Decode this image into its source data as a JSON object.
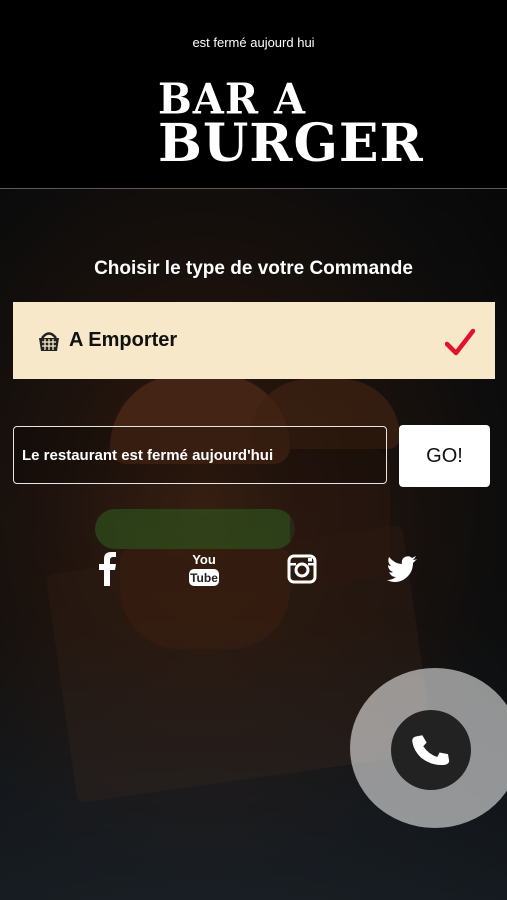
{
  "header": {
    "status_text": "est fermé aujourd hui",
    "logo_line1": "BAR A",
    "logo_line2": "BURGER"
  },
  "main": {
    "title": "Choisir le type de votre Commande",
    "order_option": {
      "label": "A Emporter",
      "selected": true,
      "icon": "basket-icon"
    },
    "closed_field": {
      "text": "Le restaurant est fermé aujourd'hui"
    },
    "go_button": {
      "label": "GO!"
    }
  },
  "social": {
    "items": [
      {
        "icon": "facebook-icon"
      },
      {
        "icon": "youtube-icon",
        "text_top": "You",
        "text_bottom": "Tube"
      },
      {
        "icon": "instagram-icon"
      },
      {
        "icon": "twitter-icon"
      }
    ]
  },
  "call_button": {
    "icon": "phone-icon"
  },
  "colors": {
    "option_bg": "#f6e8c9",
    "check": "#e3112a",
    "header_bg": "#000000"
  }
}
